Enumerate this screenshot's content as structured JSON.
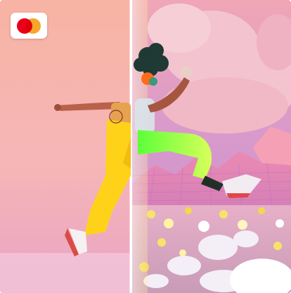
{
  "card": {
    "brand_icon": "mastercard-logo-icon",
    "colors": {
      "left_bg": "#f6b3a8",
      "right_sky": "#e9a7b8",
      "pants": "#ffd21a",
      "pants_neon": "#b7ff4a",
      "brand_red": "#eb001b",
      "brand_orange": "#f79e1b"
    }
  }
}
